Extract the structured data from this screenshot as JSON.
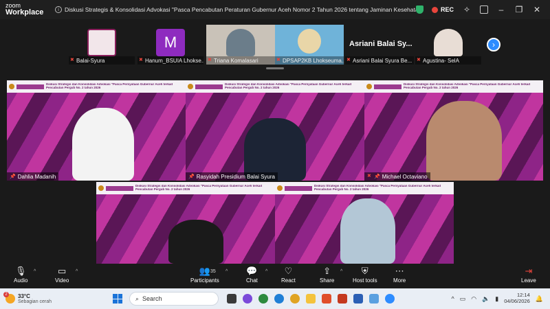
{
  "titlebar": {
    "brand_line1": "zoom",
    "brand_line2": "Workplace",
    "meeting_title": "Diskusi Strategis & Konsolidasi Advokasi \"Pasca Pencabutan Peraturan Gubernur Aceh Nomor 2 Tahun 2026 tentang Jaminan Kesehatan Aceh (JK",
    "rec_label": "REC",
    "shield_color": "#2fb36b",
    "rec_color": "#e8453c"
  },
  "strip": {
    "participants": [
      {
        "name": "Balai-Syura"
      },
      {
        "name": "Hanum_BSUIA Lhokse...",
        "initial": "M"
      },
      {
        "name": "Triana Komalasari"
      },
      {
        "name": "DPSAP2KB Lhokseuma..."
      },
      {
        "name": "Asriani Balai Syura Be...",
        "big_label": "Asriani Balai Sy..."
      },
      {
        "name": "Agustina- SelA"
      }
    ]
  },
  "tiles": {
    "banner_text": "Diskusi Strategis dan Konsolidasi Advokasi \"Pasca Pernyataan Gubernur Aceh terkait Pencabutan Pergub No. 2 tahun 2026",
    "items": [
      {
        "name": "Dahlia Madanih"
      },
      {
        "name": "Rasyidah Presidium Balai Syura"
      },
      {
        "name": "Michael Octaviano"
      },
      {
        "name": ""
      },
      {
        "name": ""
      }
    ],
    "accent": "#2fd16a"
  },
  "toolbar": {
    "audio": "Audio",
    "video": "Video",
    "participants": "Participants",
    "participants_count": "35",
    "chat": "Chat",
    "react": "React",
    "share": "Share",
    "host_tools": "Host tools",
    "more": "More",
    "leave": "Leave"
  },
  "taskbar": {
    "weather_badge": "2",
    "temp": "33°C",
    "weather_desc": "Sebagian cerah",
    "search_placeholder": "Search",
    "time": "12:14",
    "date": "04/06/2026"
  }
}
